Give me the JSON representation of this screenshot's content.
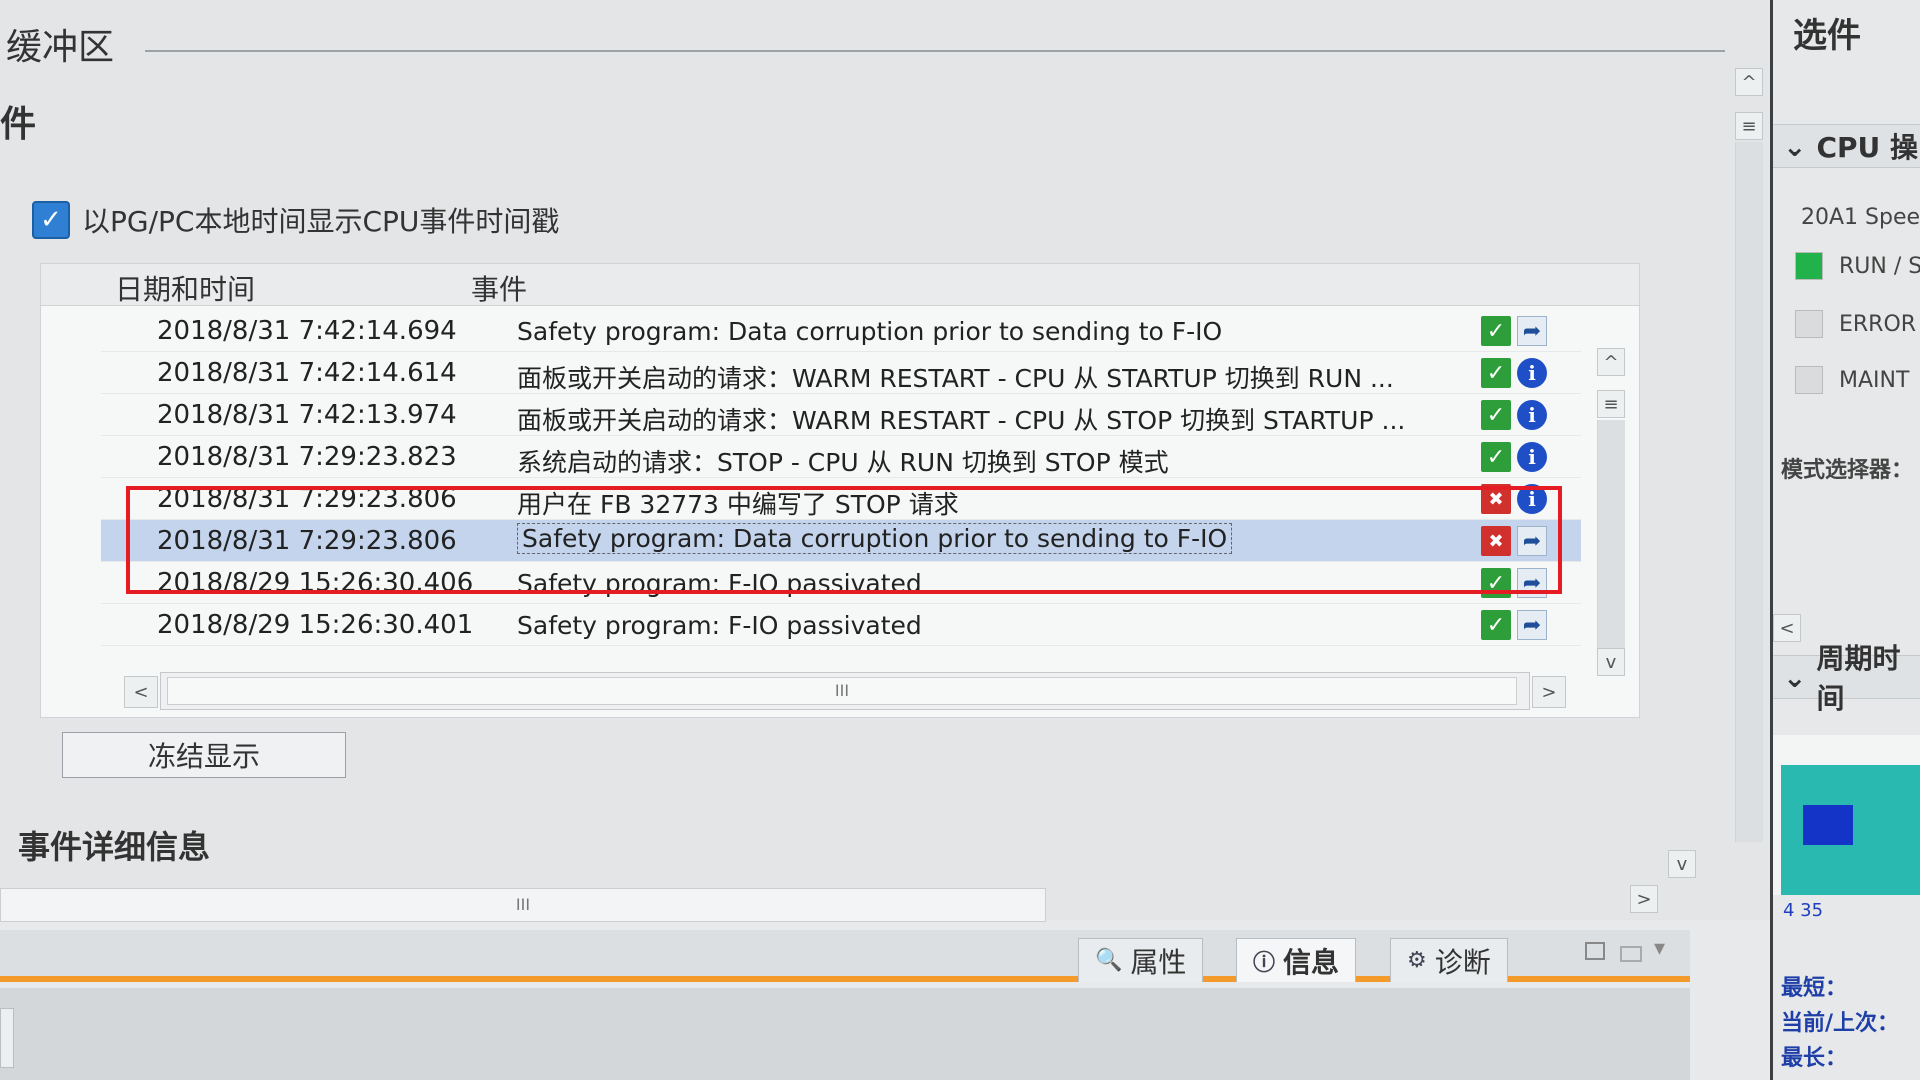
{
  "header": {
    "buffer_title": "缓冲区",
    "section_fragment": "件"
  },
  "display_option": {
    "checked": true,
    "label": "以PG/PC本地时间显示CPU事件时间戳"
  },
  "table": {
    "columns": [
      "日期和时间",
      "事件"
    ],
    "rows": [
      {
        "datetime": "2018/8/31 7:42:14.694",
        "event": "Safety program: Data corruption prior to sending to F-IO",
        "status": "ok",
        "action": "navigate"
      },
      {
        "datetime": "2018/8/31 7:42:14.614",
        "event": "面板或开关启动的请求：WARM RESTART - CPU 从 STARTUP 切换到 RUN ...",
        "status": "ok",
        "action": "info"
      },
      {
        "datetime": "2018/8/31 7:42:13.974",
        "event": "面板或开关启动的请求：WARM RESTART - CPU 从 STOP 切换到 STARTUP ...",
        "status": "ok",
        "action": "info"
      },
      {
        "datetime": "2018/8/31 7:29:23.823",
        "event": "系统启动的请求：STOP - CPU 从 RUN 切换到 STOP 模式",
        "status": "ok",
        "action": "info"
      },
      {
        "datetime": "2018/8/31 7:29:23.806",
        "event": "用户在 FB 32773 中编写了 STOP 请求",
        "status": "error",
        "action": "info"
      },
      {
        "datetime": "2018/8/31 7:29:23.806",
        "event": "Safety program: Data corruption prior to sending to F-IO",
        "status": "error",
        "action": "navigate",
        "selected": true
      },
      {
        "datetime": "2018/8/29 15:26:30.406",
        "event": "Safety program: F-IO passivated",
        "status": "ok",
        "action": "navigate"
      },
      {
        "datetime": "2018/8/29 15:26:30.401",
        "event": "Safety program: F-IO passivated",
        "status": "ok",
        "action": "navigate"
      }
    ]
  },
  "buttons": {
    "freeze": "冻结显示"
  },
  "details": {
    "title": "事件详细信息"
  },
  "scroll": {
    "thumb_label": "III",
    "left": "<",
    "right": ">",
    "up": "^",
    "down": "v",
    "menu": "≡"
  },
  "tabs": [
    {
      "label": "属性",
      "icon": "properties-icon"
    },
    {
      "label": "信息",
      "icon": "info-icon",
      "active": true
    },
    {
      "label": "诊断",
      "icon": "diagnostics-icon"
    }
  ],
  "right_panel": {
    "title": "选件",
    "cpu_header": "CPU 操",
    "cpu_name": "20A1 Spee",
    "leds": [
      {
        "label": "RUN / S",
        "color": "#22b24c"
      },
      {
        "label": "ERROR",
        "color": "#d9dbdc"
      },
      {
        "label": "MAINT",
        "color": "#d9dbdc"
      }
    ],
    "mode_selector": "模式选择器：",
    "cycle_header": "周期时间",
    "cycle_axis": "4   35",
    "stats": [
      "最短：",
      "当前/上次：",
      "最长："
    ]
  },
  "colors": {
    "highlight": "#e51c24",
    "accent": "#f49a2a",
    "selected_row": "#c3d4ec"
  }
}
